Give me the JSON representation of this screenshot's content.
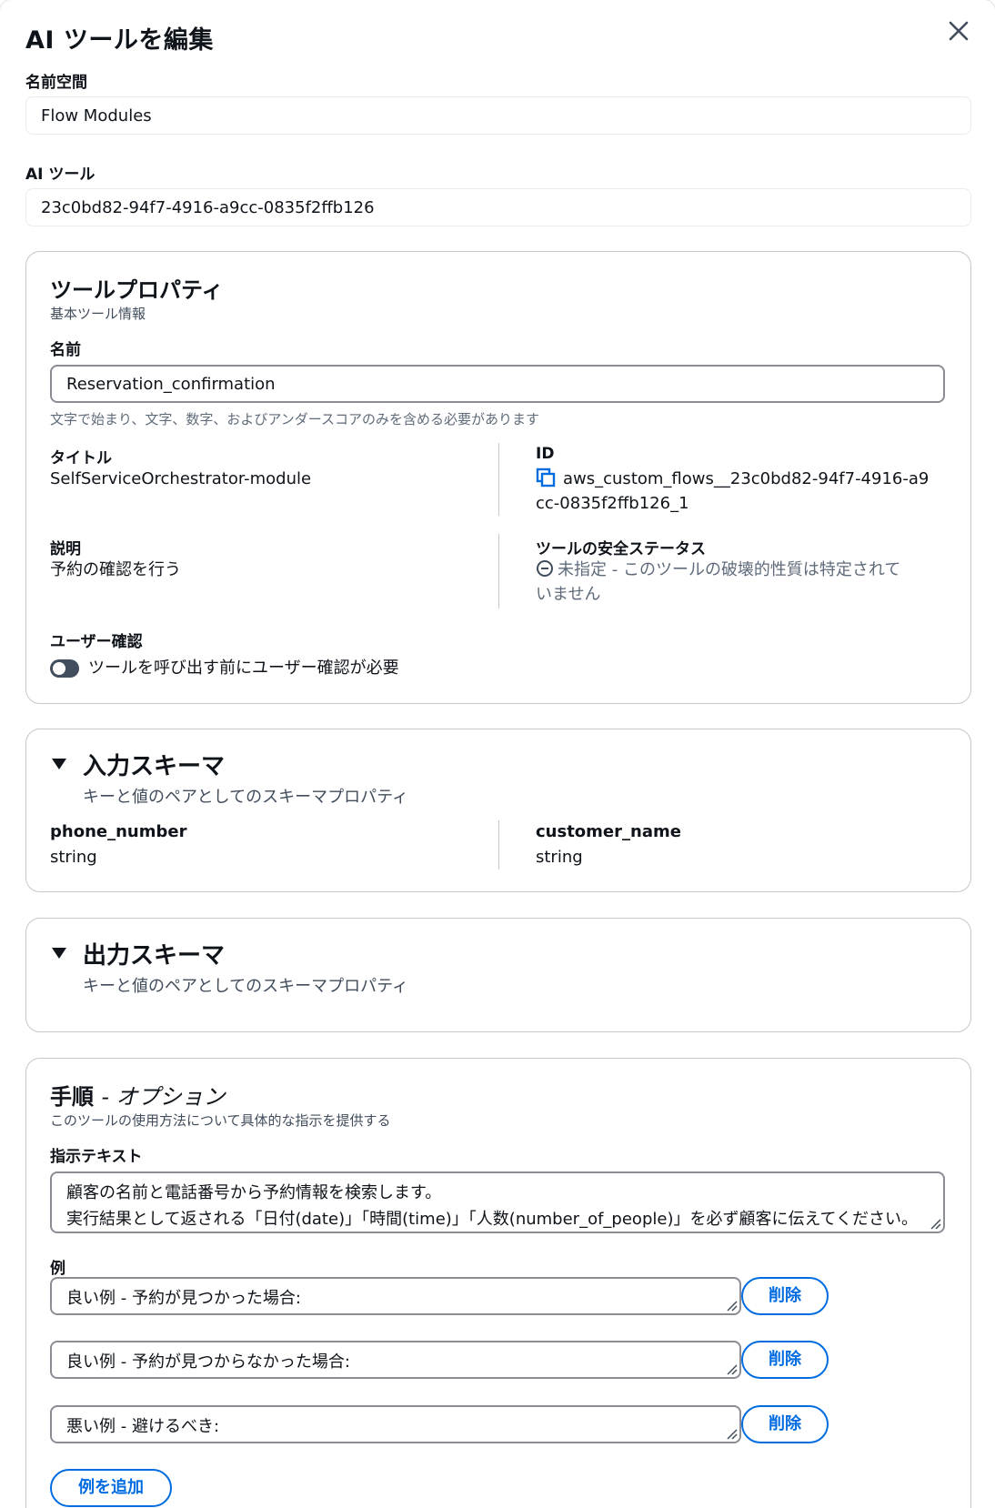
{
  "dialog": {
    "title": "AI ツールを編集",
    "namespace_label": "名前空間",
    "namespace_value": "Flow Modules",
    "ai_tool_label": "AI ツール",
    "ai_tool_value": "23c0bd82-94f7-4916-a9cc-0835f2ffb126",
    "close_icon": "close-icon"
  },
  "properties": {
    "title": "ツールプロパティ",
    "subtitle": "基本ツール情報",
    "name_label": "名前",
    "name_value": "Reservation_confirmation",
    "name_hint": "文字で始まり、文字、数字、およびアンダースコアのみを含める必要があります",
    "title_label": "タイトル",
    "title_value": "SelfServiceOrchestrator-module",
    "id_label": "ID",
    "id_line1": "aws_custom_flows__23c0bd82-94f7-4916-a9",
    "id_line2": "cc-0835f2ffb126_1",
    "description_label": "説明",
    "description_value": "予約の確認を行う",
    "safety_label": "ツールの安全ステータス",
    "safety_line1": "未指定 - このツールの破壊的性質は特定されて",
    "safety_line2": "いません",
    "user_confirm_label": "ユーザー確認",
    "user_confirm_toggle_text": "ツールを呼び出す前にユーザー確認が必要"
  },
  "input_schema": {
    "title": "入力スキーマ",
    "subtitle": "キーと値のペアとしてのスキーマプロパティ",
    "fields": [
      {
        "key": "phone_number",
        "type": "string"
      },
      {
        "key": "customer_name",
        "type": "string"
      }
    ]
  },
  "output_schema": {
    "title": "出力スキーマ",
    "subtitle": "キーと値のペアとしてのスキーマプロパティ"
  },
  "instructions": {
    "title": "手順",
    "title_suffix": "- オプション",
    "subtitle": "このツールの使用方法について具体的な指示を提供する",
    "text_label": "指示テキスト",
    "text_line1": "顧客の名前と電話番号から予約情報を検索します。",
    "text_line2": "実行結果として返される「日付(date)」「時間(time)」「人数(number_of_people)」を必ず顧客に伝えてください。",
    "examples_label": "例",
    "examples": [
      {
        "text": "良い例 - 予約が見つかった場合:",
        "delete_label": "削除"
      },
      {
        "text": "良い例 - 予約が見つからなかった場合:",
        "delete_label": "削除"
      },
      {
        "text": "悪い例 - 避けるべき:",
        "delete_label": "削除"
      }
    ],
    "add_example_label": "例を追加"
  },
  "colors": {
    "accent": "#006ce0",
    "border": "#c6c6cd",
    "text": "#0f141a"
  }
}
